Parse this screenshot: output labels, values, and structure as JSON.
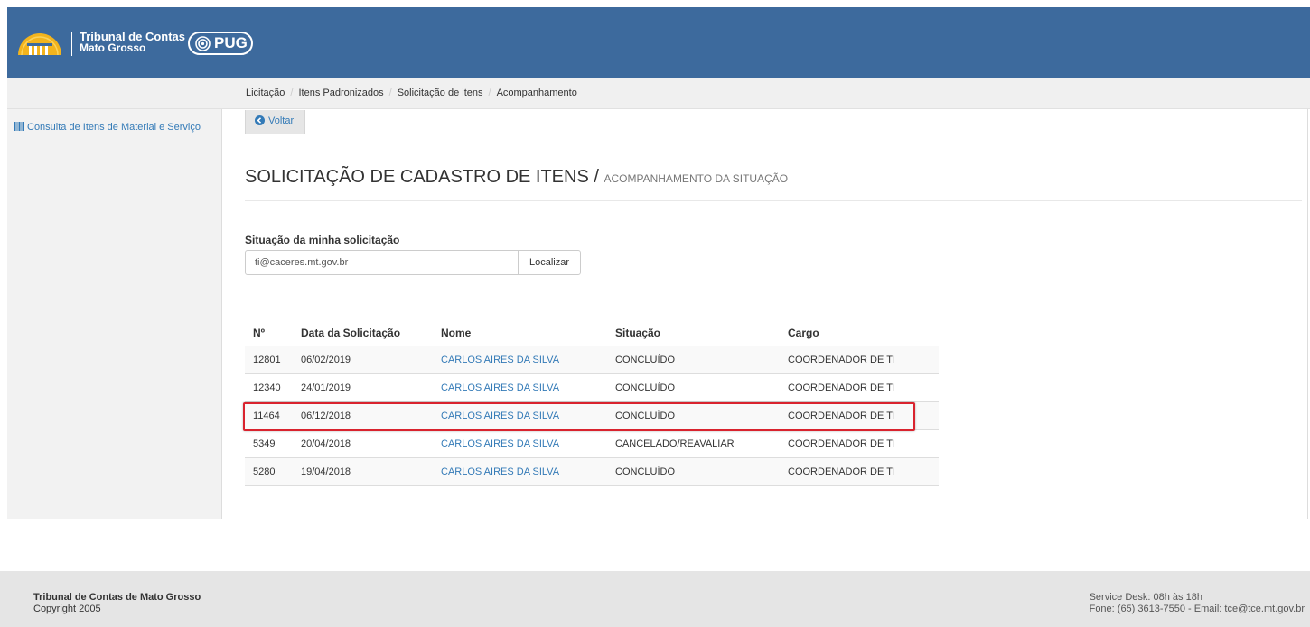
{
  "header": {
    "brand_line1": "Tribunal de Contas",
    "brand_line2": "Mato Grosso",
    "app_name": "PUG",
    "bg_color": "#3d6a9d"
  },
  "breadcrumb": [
    "Licitação",
    "Itens Padronizados",
    "Solicitação de itens",
    "Acompanhamento"
  ],
  "sidebar": {
    "items": [
      {
        "icon": "barcode-icon",
        "label": "Consulta de Itens de Material e Serviço"
      }
    ]
  },
  "main": {
    "back_button": "Voltar",
    "title": "SOLICITAÇÃO DE CADASTRO DE ITENS /",
    "subtitle": "ACOMPANHAMENTO DA SITUAÇÃO",
    "form": {
      "label": "Situação da minha solicitação",
      "email_value": "ti@caceres.mt.gov.br",
      "search_button": "Localizar"
    },
    "table": {
      "headers": [
        "Nº",
        "Data da Solicitação",
        "Nome",
        "Situação",
        "Cargo"
      ],
      "rows": [
        {
          "num": "12801",
          "date": "06/02/2019",
          "name": "CARLOS AIRES DA SILVA",
          "status": "CONCLUÍDO",
          "role": "COORDENADOR DE TI"
        },
        {
          "num": "12340",
          "date": "24/01/2019",
          "name": "CARLOS AIRES DA SILVA",
          "status": "CONCLUÍDO",
          "role": "COORDENADOR DE TI"
        },
        {
          "num": "11464",
          "date": "06/12/2018",
          "name": "CARLOS AIRES DA SILVA",
          "status": "CONCLUÍDO",
          "role": "COORDENADOR DE TI"
        },
        {
          "num": "5349",
          "date": "20/04/2018",
          "name": "CARLOS AIRES DA SILVA",
          "status": "CANCELADO/REAVALIAR",
          "role": "COORDENADOR DE TI"
        },
        {
          "num": "5280",
          "date": "19/04/2018",
          "name": "CARLOS AIRES DA SILVA",
          "status": "CONCLUÍDO",
          "role": "COORDENADOR DE TI"
        }
      ],
      "highlighted_row_index": 2,
      "highlight_color": "#d9232e"
    }
  },
  "footer": {
    "org": "Tribunal de Contas de Mato Grosso",
    "copyright": "Copyright 2005",
    "service_desk": "Service Desk: 08h às 18h",
    "contact": "Fone: (65) 3613-7550 - Email: tce@tce.mt.gov.br"
  }
}
